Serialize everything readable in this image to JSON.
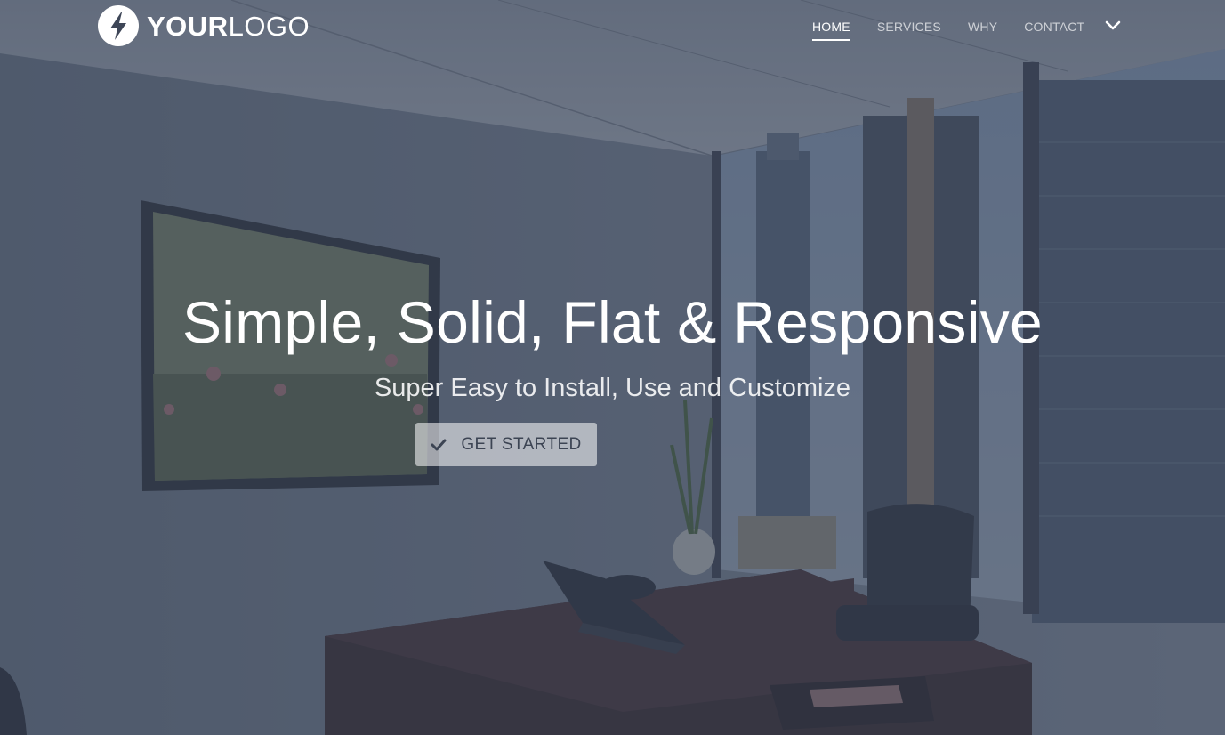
{
  "brand": {
    "logo_bold": "YOUR",
    "logo_light": "LOGO",
    "logo_icon": "lightning-bolt-icon"
  },
  "nav": {
    "items": [
      {
        "label": "HOME",
        "active": true
      },
      {
        "label": "SERVICES",
        "active": false
      },
      {
        "label": "WHY",
        "active": false
      },
      {
        "label": "CONTACT",
        "active": false
      }
    ],
    "toggle_icon": "chevron-down-icon"
  },
  "hero": {
    "title": "Simple, Solid, Flat & Responsive",
    "subtitle": "Super Easy to Install, Use and Customize",
    "cta_label": "GET STARTED",
    "cta_icon": "check-icon"
  },
  "colors": {
    "overlay": "#344056",
    "text": "#ffffff",
    "button_bg": "#ffffff",
    "button_text": "#3c4453"
  }
}
